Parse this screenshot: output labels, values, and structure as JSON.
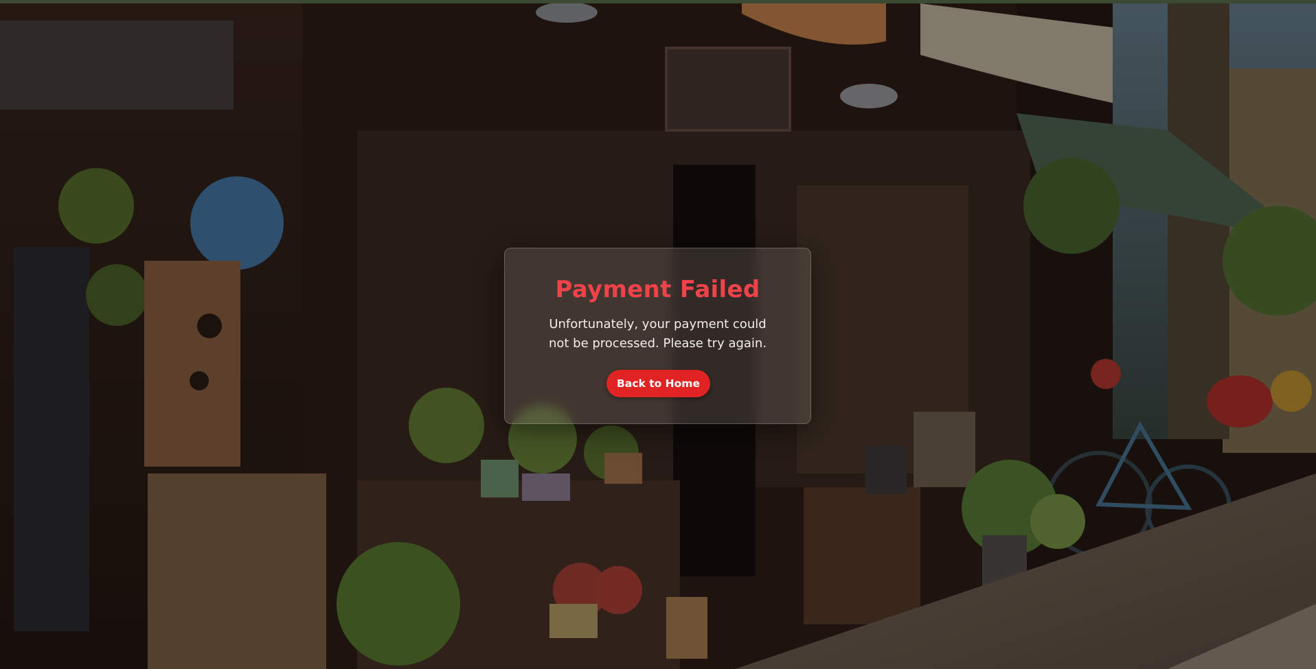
{
  "modal": {
    "title": "Payment Failed",
    "message": "Unfortunately, your payment could not be processed. Please try again.",
    "button_label": "Back to Home"
  },
  "colors": {
    "title": "#ef4349",
    "button": "#e02424",
    "top_bar": "#3c4a34"
  }
}
